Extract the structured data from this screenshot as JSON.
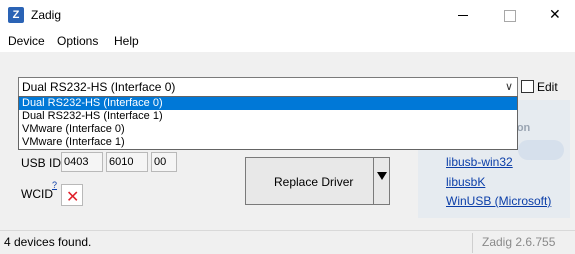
{
  "window": {
    "title": "Zadig",
    "icon_letter": "Z",
    "icons": {
      "app": "zadig-app-icon",
      "minimize": "minimize-icon",
      "maximize": "maximize-icon",
      "close": "close-icon"
    },
    "close_glyph": "✕"
  },
  "menu": {
    "items": [
      {
        "label": "Device"
      },
      {
        "label": "Options"
      },
      {
        "label": "Help"
      }
    ]
  },
  "device_select": {
    "value": "Dual RS232-HS (Interface 0)",
    "arrow": "∨",
    "options": [
      "Dual RS232-HS (Interface 0)",
      "Dual RS232-HS (Interface 1)",
      "VMware (Interface 0)",
      "VMware (Interface 1)"
    ],
    "selected_index": 0
  },
  "edit": {
    "label": "Edit",
    "checked": false
  },
  "usb": {
    "label": "USB ID",
    "vid": "0403",
    "pid": "6010",
    "mi": "00"
  },
  "wcid": {
    "label": "WCID",
    "superscript": "?",
    "status_icon": "red-x-icon",
    "glyph": "✕"
  },
  "replace_button": {
    "label": "Replace Driver"
  },
  "right_panel": {
    "partial_title": "ation",
    "links": [
      "libusb-win32",
      "libusbK",
      "WinUSB (Microsoft)"
    ]
  },
  "status": {
    "left": "4 devices found.",
    "right": "Zadig 2.6.755"
  },
  "colors": {
    "selection": "#0078d7",
    "link": "#0b3ea8",
    "error": "#e0202a"
  }
}
